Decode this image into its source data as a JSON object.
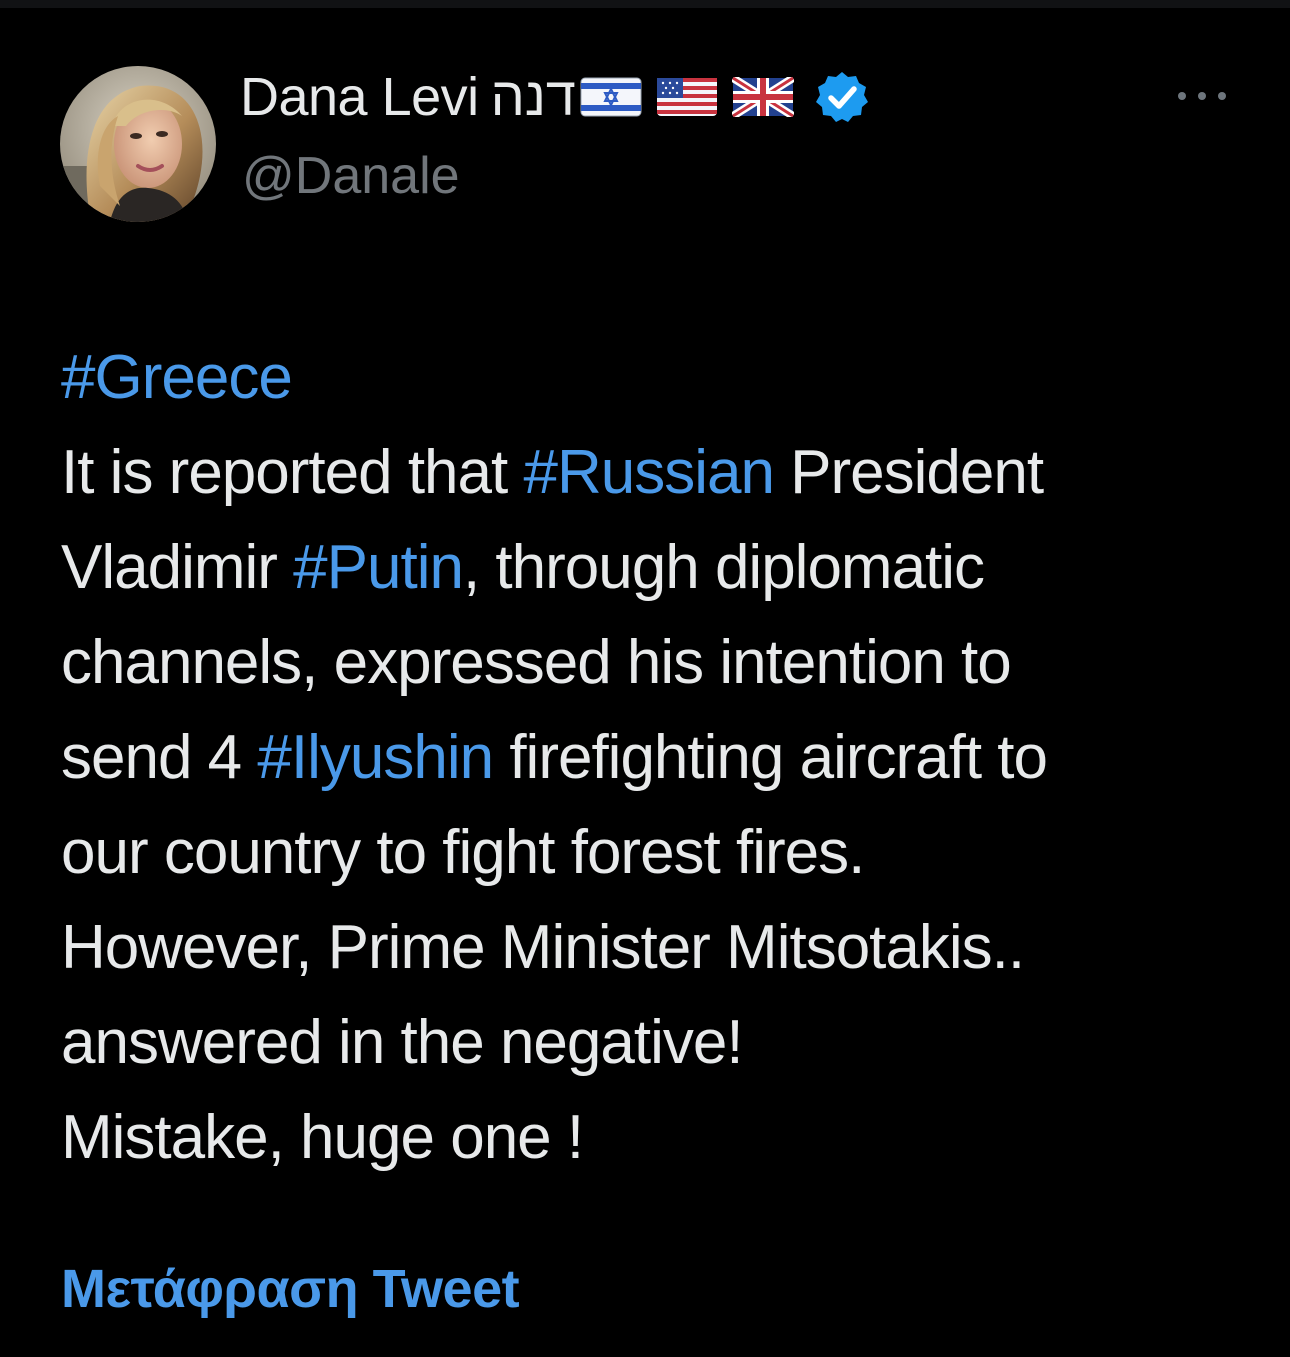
{
  "tweet": {
    "author": {
      "display_name": "Dana Levi",
      "name_hebrew": "דנה",
      "flags": [
        "israel-flag",
        "usa-flag",
        "uk-flag"
      ],
      "verified": true,
      "handle": "@Danale",
      "avatar": "profile-photo"
    },
    "more_icon": "more-horizontal-icon",
    "lines": [
      [
        {
          "text": "#Greece",
          "tag": true
        }
      ],
      [
        {
          "text": "It is reported that ",
          "tag": false
        },
        {
          "text": "#Russian",
          "tag": true
        },
        {
          "text": " President",
          "tag": false
        }
      ],
      [
        {
          "text": "Vladimir ",
          "tag": false
        },
        {
          "text": "#Putin",
          "tag": true
        },
        {
          "text": ", through diplomatic",
          "tag": false
        }
      ],
      [
        {
          "text": "channels, expressed his intention to",
          "tag": false
        }
      ],
      [
        {
          "text": "send 4 ",
          "tag": false
        },
        {
          "text": "#Ilyushin",
          "tag": true
        },
        {
          "text": " firefighting aircraft to",
          "tag": false
        }
      ],
      [
        {
          "text": "our country to fight forest fires.",
          "tag": false
        }
      ],
      [
        {
          "text": "However, Prime Minister Mitsotakis..",
          "tag": false
        }
      ],
      [
        {
          "text": "answered in the negative!",
          "tag": false
        }
      ],
      [
        {
          "text": "Mistake, huge one !",
          "tag": false
        }
      ]
    ],
    "translate_label": "Μετάφραση Tweet"
  },
  "colors": {
    "background": "#000000",
    "text_primary": "#e7e9ea",
    "text_secondary": "#71767b",
    "link": "#4a99e9",
    "verified_badge": "#1d9bf0"
  }
}
